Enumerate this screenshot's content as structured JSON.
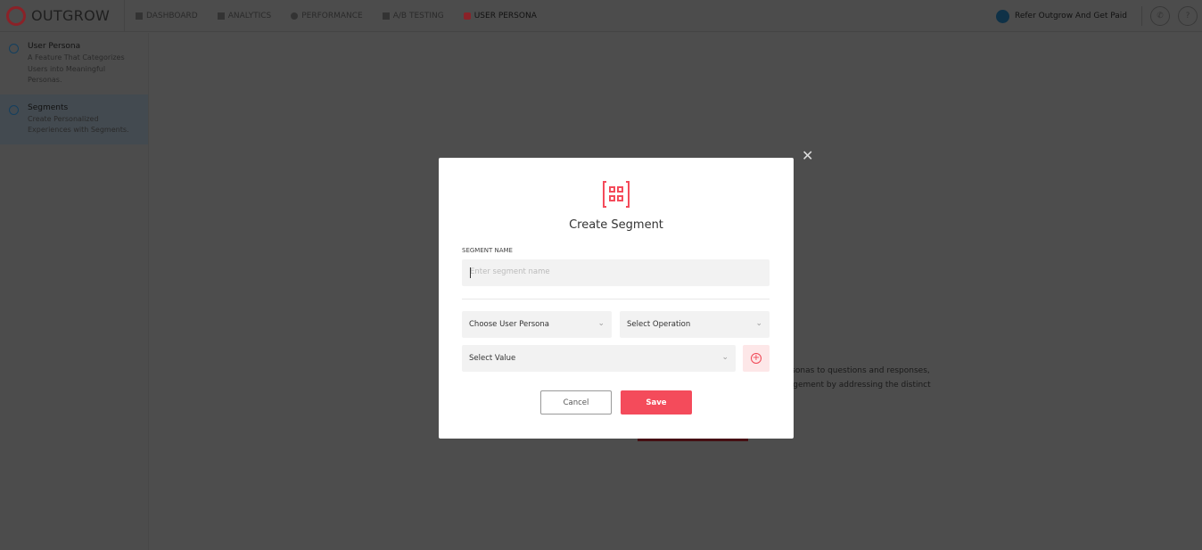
{
  "header": {
    "brand": "OUTGROW",
    "nav": [
      {
        "label": "DASHBOARD"
      },
      {
        "label": "ANALYTICS"
      },
      {
        "label": "PERFORMANCE"
      },
      {
        "label": "A/B TESTING"
      },
      {
        "label": "USER PERSONA",
        "active": true
      }
    ],
    "refer": "Refer Outgrow And Get Paid",
    "phone_icon": "phone-icon",
    "help": "?"
  },
  "sidebar": {
    "items": [
      {
        "title": "User Persona",
        "desc": "A Feature That Categorizes Users into Meaningful Personas."
      },
      {
        "title": "Segments",
        "desc": "Create Personalized Experiences with Segments.",
        "active": true
      }
    ]
  },
  "background": {
    "line1": "ersonas to questions and responses,",
    "line2": "gagement by addressing the distinct"
  },
  "modal": {
    "title": "Create Segment",
    "name_label": "SEGMENT NAME",
    "name_placeholder": "Enter segment name",
    "persona_select": "Choose User Persona",
    "operation_select": "Select Operation",
    "value_select": "Select Value",
    "cancel": "Cancel",
    "save": "Save"
  },
  "colors": {
    "accent": "#f44b5b",
    "brand": "#e5323f",
    "sidebar_active": "#e7f0f8"
  }
}
